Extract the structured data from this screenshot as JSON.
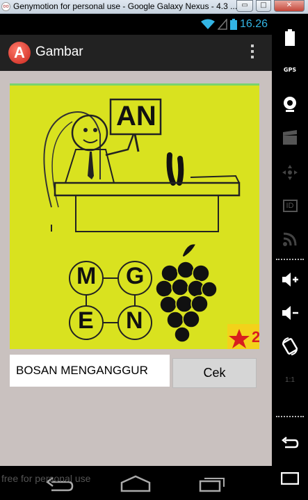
{
  "window": {
    "title": "Genymotion for personal use - Google Galaxy Nexus - 4.3 ...",
    "minimize": "▭",
    "maximize": "□",
    "close": "✕"
  },
  "status_bar": {
    "time": "16.26"
  },
  "action_bar": {
    "app_logo": "A",
    "title": "Gambar"
  },
  "puzzle": {
    "sign_text": "AN",
    "letters": [
      "M",
      "G",
      "E",
      "N"
    ],
    "level_badge": "2"
  },
  "answer": {
    "value": "BOSAN MENGANGGUR"
  },
  "button": {
    "check_label": "Cek"
  },
  "watermark": "free for personal use",
  "icons": {
    "back": "back-icon",
    "home": "home-icon",
    "recents": "recent-apps-icon",
    "battery": "battery-icon",
    "gps": "GPS",
    "webcam": "webcam-icon",
    "video": "video-clapper-icon",
    "dpad": "dpad-icon",
    "id": "ID",
    "rss": "rss-icon",
    "volume_up": "volume-up-icon",
    "volume_down": "volume-down-icon",
    "rotate": "rotate-icon",
    "scale": "1:1"
  }
}
